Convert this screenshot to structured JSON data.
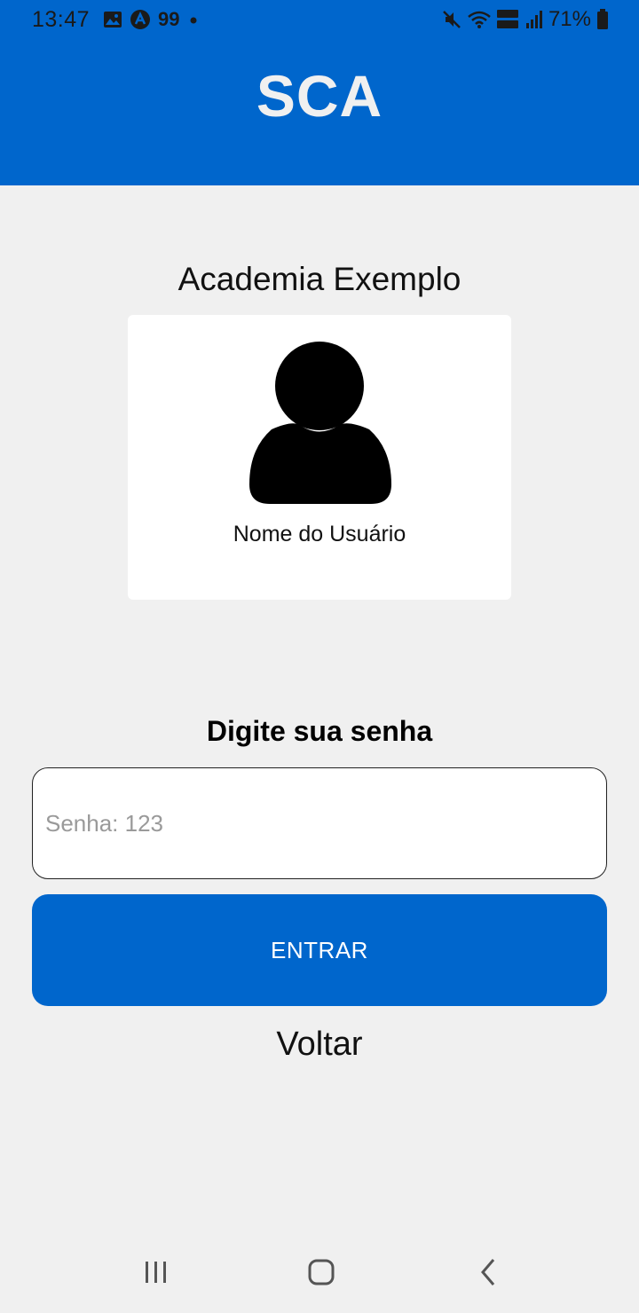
{
  "status_bar": {
    "time": "13:47",
    "badge_text": "99",
    "battery": "71%",
    "left_icons": [
      "gallery-icon",
      "app-a-icon",
      "notification-99-icon",
      "dot-icon"
    ],
    "right_icons": [
      "mute-icon",
      "wifi-icon",
      "volte-lte-icon",
      "signal-icon",
      "battery-icon"
    ]
  },
  "header": {
    "title": "SCA",
    "background_color": "#0066cc"
  },
  "main": {
    "academy_name": "Academia Exemplo",
    "user_card": {
      "avatar_icon": "user-avatar-icon",
      "user_name": "Nome do Usuário"
    },
    "prompt": "Digite sua senha",
    "password_placeholder": "Senha: 123",
    "password_value": "",
    "enter_button_label": "ENTRAR",
    "back_label": "Voltar",
    "accent_color": "#0066cc"
  },
  "nav_bar": {
    "buttons": [
      "recent-apps-icon",
      "home-icon",
      "back-icon"
    ]
  }
}
